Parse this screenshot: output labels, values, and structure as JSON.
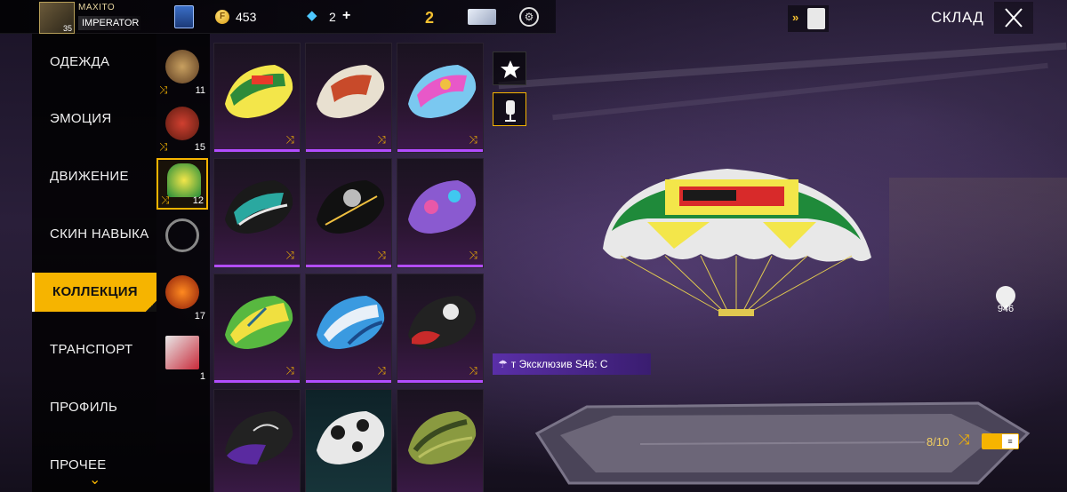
{
  "header": {
    "player_name": "MAXITO",
    "player_rank_title": "IMPERATOR",
    "avatar_level": "35",
    "coins": "453",
    "diamonds": "2",
    "diamonds_plus": "+",
    "level_badge": "2",
    "screen_title": "СКЛАД"
  },
  "nav": {
    "items": [
      {
        "label": "ОДЕЖДА"
      },
      {
        "label": "ЭМОЦИЯ"
      },
      {
        "label": "ДВИЖЕНИЕ"
      },
      {
        "label": "СКИН НАВЫКА"
      },
      {
        "label": "КОЛЛЕКЦИЯ"
      },
      {
        "label": "ТРАНСПОРТ"
      },
      {
        "label": "ПРОФИЛЬ"
      },
      {
        "label": "ПРОЧЕЕ"
      }
    ],
    "active_index": 4
  },
  "subcategories": [
    {
      "name": "shield-emblem",
      "count": "11",
      "shuffle": true
    },
    {
      "name": "warrior-helmet",
      "count": "15",
      "shuffle": true
    },
    {
      "name": "parachute",
      "count": "12",
      "shuffle": true,
      "active": true
    },
    {
      "name": "plane-emblem",
      "count": "",
      "shuffle": false
    },
    {
      "name": "fire-trail",
      "count": "17",
      "shuffle": false
    },
    {
      "name": "character-banner",
      "count": "1",
      "shuffle": false
    }
  ],
  "grid_items": [
    {
      "colors": [
        "#f3e64a",
        "#2e8b3a",
        "#e83a2a"
      ]
    },
    {
      "colors": [
        "#e8e0d0",
        "#c84a2a",
        "#333333"
      ]
    },
    {
      "colors": [
        "#7ac8f0",
        "#e858c8",
        "#f0c040"
      ]
    },
    {
      "colors": [
        "#1a1a1a",
        "#2aa8a0",
        "#e8e8e8"
      ]
    },
    {
      "colors": [
        "#111111",
        "#f0c040",
        "#bbbbbb"
      ]
    },
    {
      "colors": [
        "#8a5ad0",
        "#e858a8",
        "#40c8f0"
      ]
    },
    {
      "colors": [
        "#58b840",
        "#f0e040",
        "#2a6a8a"
      ]
    },
    {
      "colors": [
        "#3a9ae0",
        "#e8f0f8",
        "#1a4a8a"
      ]
    },
    {
      "colors": [
        "#c82a2a",
        "#e8e8e8",
        "#222222"
      ]
    },
    {
      "colors": [
        "#5a2aa0",
        "#222222",
        "#d8d8d8"
      ]
    },
    {
      "colors": [
        "#e8e8e8",
        "#1a1a1a",
        "#2a8a9a"
      ]
    },
    {
      "colors": [
        "#8a9a40",
        "#3a4a20",
        "#b8c060"
      ]
    }
  ],
  "item_tag": "т Эксклюзив S46: C",
  "likes_count": "946",
  "equipped_count": "8/10",
  "toggle_label": "≡",
  "colors": {
    "accent": "#f6b400",
    "rarity_bar": "#b24dff",
    "tag_bg": "#5a2fa8"
  }
}
